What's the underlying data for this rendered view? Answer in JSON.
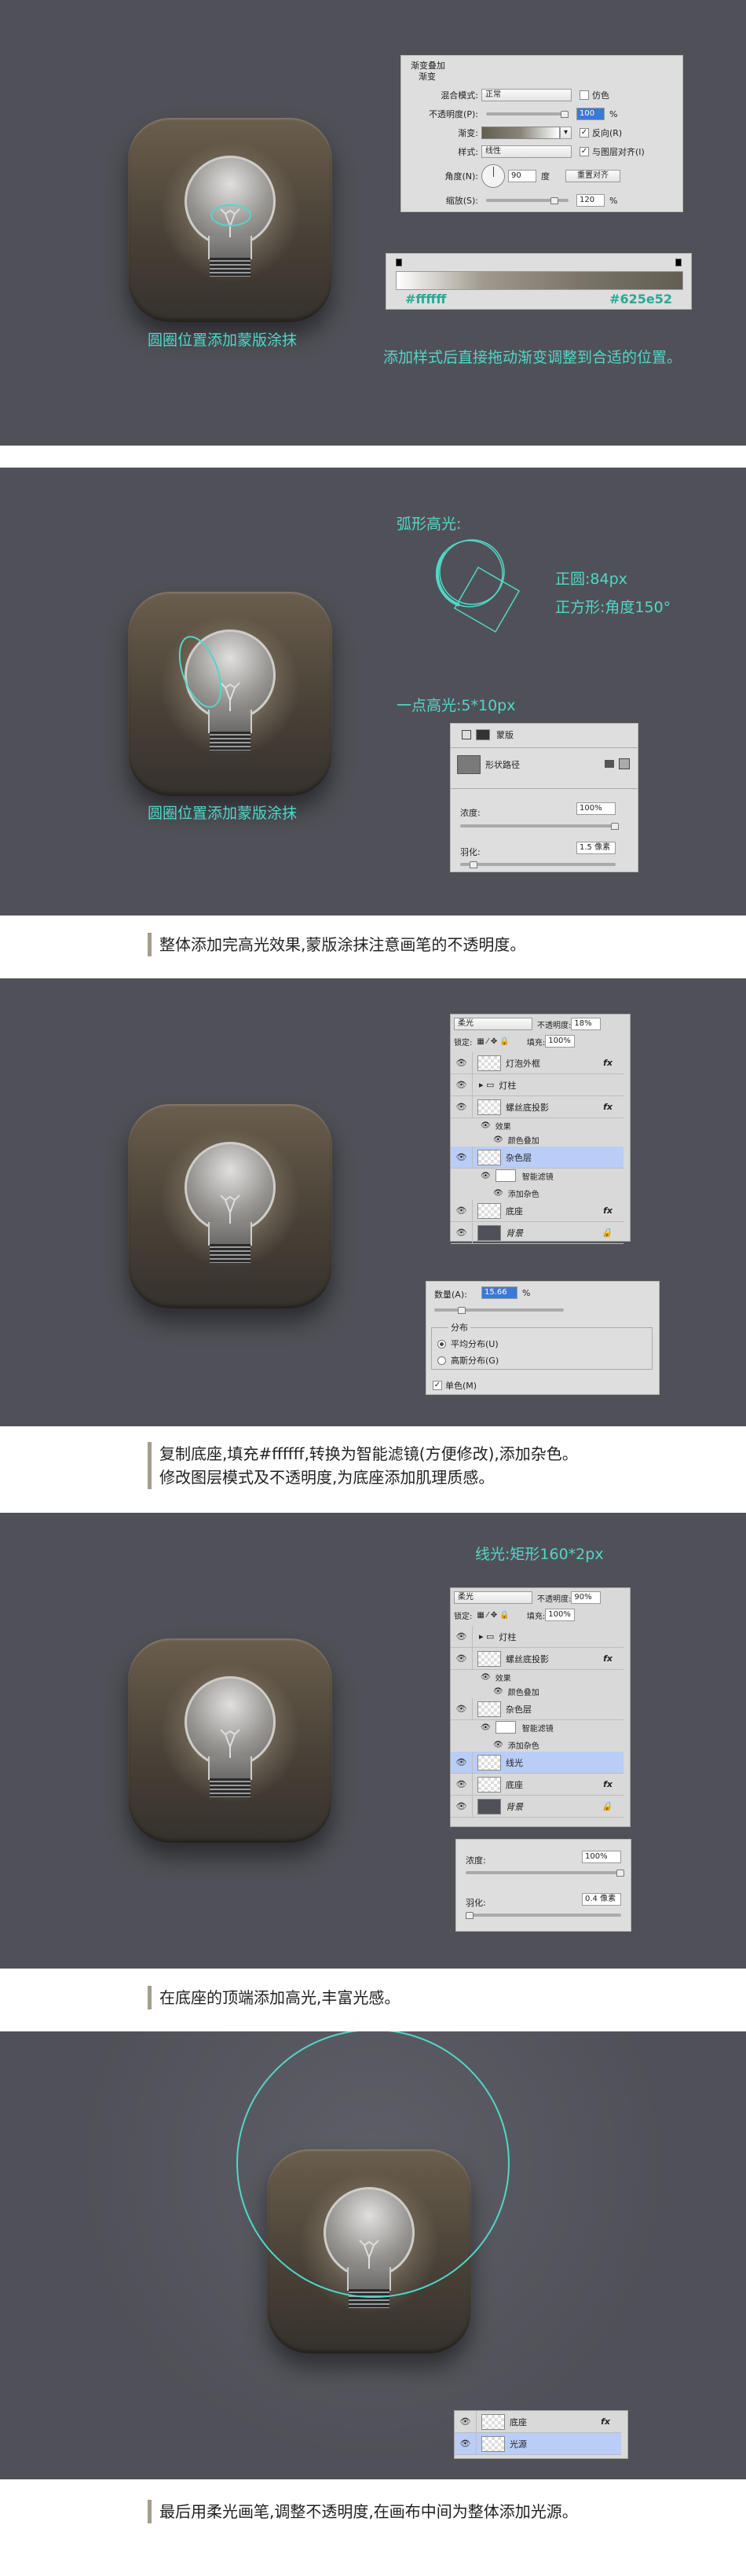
{
  "colors": {
    "panel_bg": "#505158",
    "accent": "#52d6c8",
    "caption_bar": "#a39d8f",
    "gradient_start": "#ffffff",
    "gradient_end": "#625e52"
  },
  "step1": {
    "icon_label": "圆圈位置添加蒙版涂抹",
    "instruction": "添加样式后直接拖动渐变调整到合适的位置。",
    "dialog": {
      "title": "渐变叠加",
      "group": "渐变",
      "blend_mode_label": "混合模式:",
      "blend_mode_value": "正常",
      "dither_label": "仿色",
      "opacity_label": "不透明度(P):",
      "opacity_value": "100",
      "opacity_unit": "%",
      "opacity_pct": 100,
      "gradient_label": "渐变:",
      "reverse_label": "反向(R)",
      "style_label": "样式:",
      "style_value": "线性",
      "align_label": "与图层对齐(I)",
      "angle_label": "角度(N):",
      "angle_value": "90",
      "angle_unit": "度",
      "reset_label": "重置对齐",
      "scale_label": "缩放(S):",
      "scale_value": "120",
      "scale_unit": "%",
      "scale_pct": 80
    },
    "gradient_editor": {
      "start_color": "#ffffff",
      "end_color": "#625e52"
    }
  },
  "step2": {
    "icon_label": "圆圈位置添加蒙版涂抹",
    "arc_title": "弧形高光:",
    "circle_note": "正圆:84px",
    "square_note": "正方形:角度150°",
    "dot_title": "一点高光:5*10px",
    "mask_panel": {
      "tab": "蒙版",
      "row_label": "形状路径",
      "density_label": "浓度:",
      "density_value": "100%",
      "density_pct": 100,
      "feather_label": "羽化:",
      "feather_value": "1.5 像素",
      "feather_pct": 6
    },
    "caption": "整体添加完高光效果,蒙版涂抹注意画笔的不透明度。"
  },
  "step3": {
    "layers": {
      "blend": "柔光",
      "opacity_label": "不透明度:",
      "opacity": "18%",
      "lock_label": "锁定:",
      "fill_label": "填充:",
      "fill": "100%",
      "rows": [
        {
          "name": "灯泡外框",
          "fx": "fx"
        },
        {
          "name": "灯柱"
        },
        {
          "name": "螺丝底投影",
          "fx": "fx"
        },
        {
          "name": "效果"
        },
        {
          "name": "颜色叠加"
        },
        {
          "name": "杂色层"
        },
        {
          "name": "智能滤镜"
        },
        {
          "name": "添加杂色"
        },
        {
          "name": "底座",
          "fx": "fx"
        },
        {
          "name": "背景"
        }
      ]
    },
    "noise": {
      "amount_label": "数量(A):",
      "amount": "15.66",
      "unit": "%",
      "amount_pct": 20,
      "dist_label": "分布",
      "uniform": "平均分布(U)",
      "gaussian": "高斯分布(G)",
      "mono": "单色(M)"
    },
    "caption": "复制底座,填充#ffffff,转换为智能滤镜(方便修改),添加杂色。修改图层模式及不透明度,为底座添加肌理质感。"
  },
  "step4": {
    "title": "线光:矩形160*2px",
    "layers": {
      "blend": "柔光",
      "opacity_label": "不透明度:",
      "opacity": "90%",
      "lock_label": "锁定:",
      "fill_label": "填充:",
      "fill": "100%",
      "rows": [
        {
          "name": "灯柱"
        },
        {
          "name": "螺丝底投影",
          "fx": "fx"
        },
        {
          "name": "效果"
        },
        {
          "name": "颜色叠加"
        },
        {
          "name": "杂色层"
        },
        {
          "name": "智能滤镜"
        },
        {
          "name": "添加杂色"
        },
        {
          "name": "线光"
        },
        {
          "name": "底座",
          "fx": "fx"
        },
        {
          "name": "背景"
        }
      ]
    },
    "mask_panel": {
      "density_label": "浓度:",
      "density_value": "100%",
      "density_pct": 100,
      "feather_label": "羽化:",
      "feather_value": "0.4 像素",
      "feather_pct": 2
    },
    "caption": "在底座的顶端添加高光,丰富光感。"
  },
  "step5": {
    "layers": [
      {
        "name": "底座",
        "fx": "fx"
      },
      {
        "name": "光源"
      }
    ],
    "caption": "最后用柔光画笔,调整不透明度,在画布中间为整体添加光源。"
  }
}
